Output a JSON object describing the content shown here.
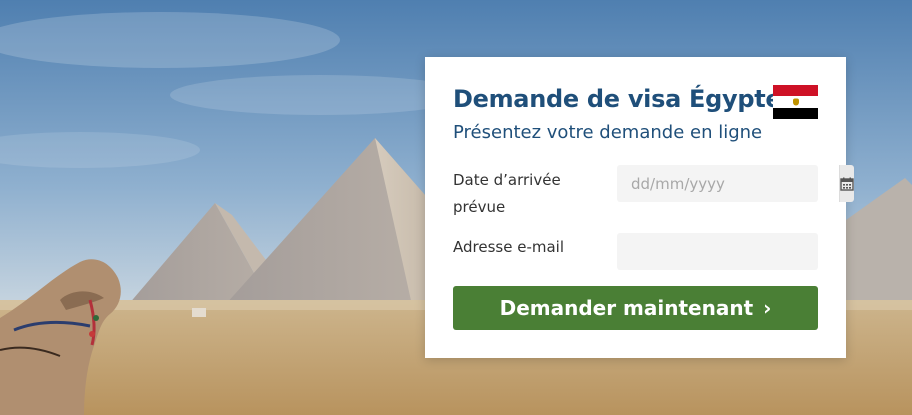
{
  "form": {
    "title": "Demande de visa Égypte",
    "subtitle": "Présentez votre demande en ligne",
    "flag_icon": "egypt-flag-icon",
    "arrival_date": {
      "label": "Date d’arrivée prévue",
      "placeholder": "dd/mm/yyyy",
      "value": "",
      "icon": "calendar-icon"
    },
    "email": {
      "label": "Adresse e-mail",
      "placeholder": "",
      "value": ""
    },
    "submit": {
      "label": "Demander maintenant",
      "icon": "chevron-right-icon"
    }
  },
  "colors": {
    "title": "#1f4f7a",
    "button": "#4a7f35",
    "flag_red": "#ce1126",
    "flag_white": "#ffffff",
    "flag_black": "#000000",
    "sky_top": "#4f7fb0",
    "sand": "#cdb58d"
  }
}
